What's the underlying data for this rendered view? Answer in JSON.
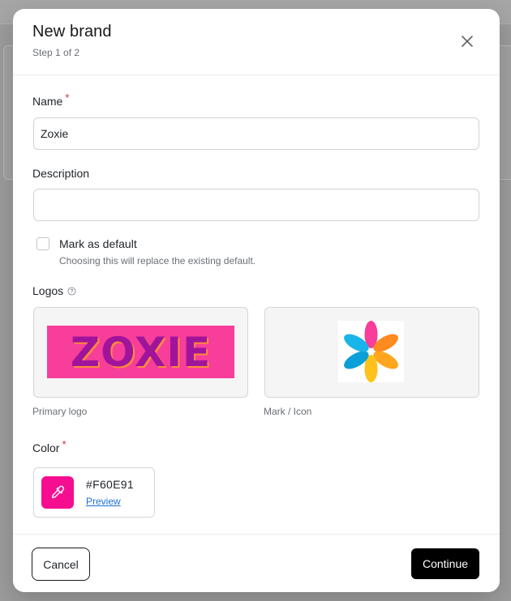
{
  "modal": {
    "title": "New brand",
    "subtitle": "Step 1 of 2"
  },
  "icons": {
    "close": "close-icon",
    "help": "help-circle-icon",
    "color_picker": "eyedropper-icon"
  },
  "form": {
    "name": {
      "label": "Name",
      "required_marker": "*",
      "value": "Zoxie"
    },
    "description": {
      "label": "Description",
      "value": ""
    },
    "mark_default": {
      "label": "Mark as default",
      "help": "Choosing this will replace the existing default.",
      "checked": false
    },
    "logos": {
      "label": "Logos",
      "primary": {
        "caption": "Primary logo",
        "wordmark": "ZOXIE"
      },
      "mark": {
        "caption": "Mark / Icon"
      }
    },
    "color": {
      "label": "Color",
      "required_marker": "*",
      "hex": "#F60E91",
      "preview_label": "Preview",
      "value": "#F60E91"
    }
  },
  "footer": {
    "cancel_label": "Cancel",
    "continue_label": "Continue"
  },
  "colors": {
    "accent": "#F60E91",
    "primary_button": "#000000",
    "required": "#D9283A",
    "link": "#1F6FD1"
  }
}
